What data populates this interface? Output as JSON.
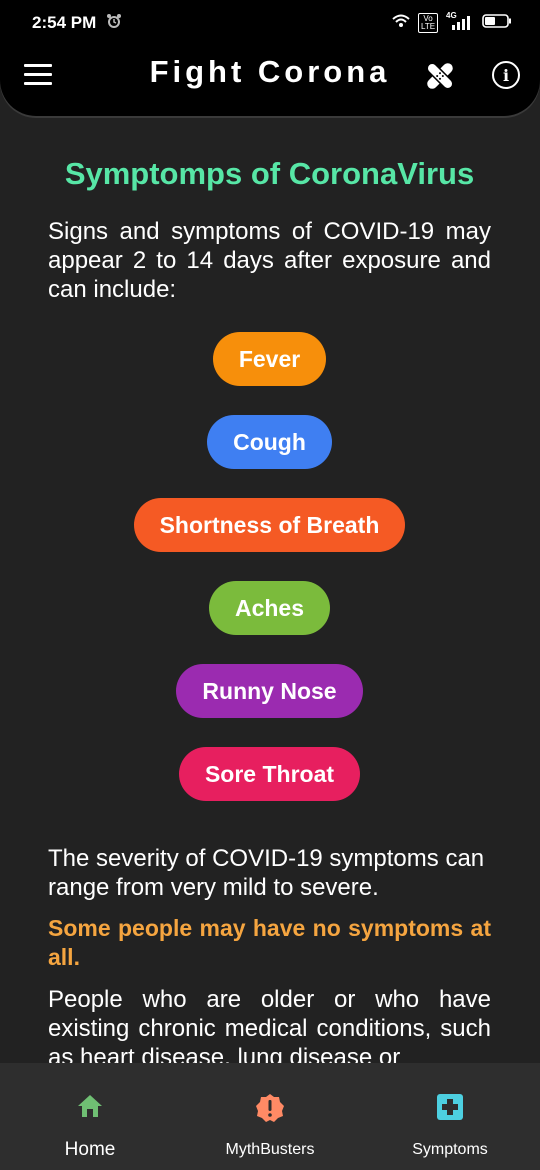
{
  "status": {
    "time": "2:54 PM",
    "network": "4G",
    "volte": "Vo LTE"
  },
  "app": {
    "title": "Fight Corona"
  },
  "main": {
    "title": "Symptomps of CoronaVirus",
    "intro": "Signs and symptoms of COVID-19 may appear 2 to 14 days after exposure and can include:",
    "symptoms": [
      {
        "label": "Fever",
        "color": "#f78f0b"
      },
      {
        "label": "Cough",
        "color": "#3f7ff2"
      },
      {
        "label": "Shortness of Breath",
        "color": "#f55a24"
      },
      {
        "label": "Aches",
        "color": "#7bbb3c"
      },
      {
        "label": "Runny Nose",
        "color": "#9b2bb0"
      },
      {
        "label": "Sore Throat",
        "color": "#e71f5f"
      }
    ],
    "severity": "The severity of COVID-19 symptoms can range from very mild to severe.",
    "highlight": "Some people may have no symptoms at all.",
    "older": "People who are older or who have existing chronic medical conditions, such as heart disease, lung disease or"
  },
  "nav": {
    "items": [
      {
        "label": "Home",
        "icon": "home-icon",
        "color": "#6fbf73"
      },
      {
        "label": "MythBusters",
        "icon": "badge-alert-icon",
        "color": "#ff8a65"
      },
      {
        "label": "Symptoms",
        "icon": "medical-cross-icon",
        "color": "#4dd0e1"
      }
    ],
    "active": "Home"
  },
  "colors": {
    "accent_title": "#57e6a6",
    "highlight": "#f5a540",
    "background": "#222222"
  }
}
